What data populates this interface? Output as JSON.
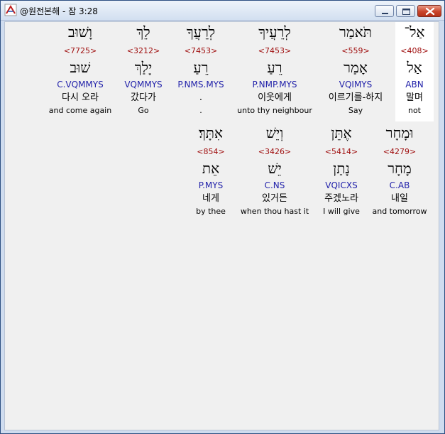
{
  "window": {
    "title": "@원전본해 - 잠 3:28"
  },
  "words": [
    {
      "hebrew": "אַל־",
      "strong": "<408>",
      "lemma": "אַל",
      "morph": "ABN",
      "korean": "말며",
      "english": "not"
    },
    {
      "hebrew": "תֹּאמַר",
      "strong": "<559>",
      "lemma": "אָמַר",
      "morph": "VQIMYS",
      "korean": "이르기를-하지",
      "english": "Say"
    },
    {
      "hebrew": "לְרֵעֲיךָ",
      "strong": "<7453>",
      "lemma": "רֵעַ",
      "morph": "P.NMP.MYS",
      "korean": "이웃에게",
      "english": "unto thy neighbour"
    },
    {
      "hebrew": "לְרֵעֲךָ",
      "strong": "<7453>",
      "lemma": "רֵעַ",
      "morph": "P.NMS.MYS",
      "korean": ".",
      "english": "."
    },
    {
      "hebrew": "לֵךְ",
      "strong": "<3212>",
      "lemma": "יָלַךְ",
      "morph": "VQMMYS",
      "korean": "갔다가",
      "english": "Go"
    },
    {
      "hebrew": "וָשׁוּב",
      "strong": "<7725>",
      "lemma": "שׁוּב",
      "morph": "C.VQMMYS",
      "korean": "다시 오라",
      "english": "and come again"
    },
    {
      "hebrew": "וּמָחָר",
      "strong": "<4279>",
      "lemma": "מָחָר",
      "morph": "C.AB",
      "korean": "내일",
      "english": "and tomorrow"
    },
    {
      "hebrew": "אֶתֵּן",
      "strong": "<5414>",
      "lemma": "נָתַן",
      "morph": "VQICXS",
      "korean": "주겠노라",
      "english": "I will give"
    },
    {
      "hebrew": "וְיֵשׁ",
      "strong": "<3426>",
      "lemma": "יֵשׁ",
      "morph": "C.NS",
      "korean": "있거든",
      "english": "when thou hast it"
    },
    {
      "hebrew": "אִתָּךְ׃",
      "strong": "<854>",
      "lemma": "אֵת",
      "morph": "P.MYS",
      "korean": "네게",
      "english": "by thee"
    }
  ]
}
